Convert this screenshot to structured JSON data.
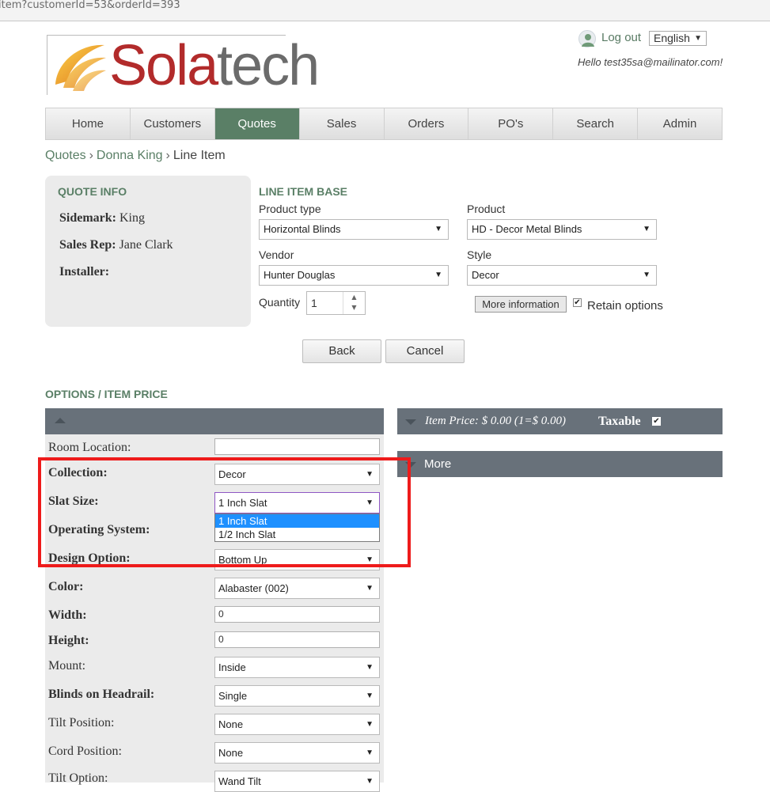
{
  "url": {
    "text": "item?customerId=53&orderId=393"
  },
  "brand": {
    "part1": "Sola",
    "part2": "tech"
  },
  "user": {
    "logout": "Log out",
    "language": "English",
    "greeting": "Hello test35sa@mailinator.com!"
  },
  "nav": {
    "tabs": [
      "Home",
      "Customers",
      "Quotes",
      "Sales",
      "Orders",
      "PO's",
      "Search",
      "Admin"
    ],
    "active": "Quotes"
  },
  "breadcrumb": {
    "b1": "Quotes",
    "b2": "Donna King",
    "b3": "Line Item",
    "sep": "›"
  },
  "quote_info": {
    "title": "QUOTE INFO",
    "sidemark_label": "Sidemark:",
    "sidemark_value": "King",
    "salesrep_label": "Sales Rep:",
    "salesrep_value": "Jane Clark",
    "installer_label": "Installer:"
  },
  "line_item_base": {
    "title": "LINE ITEM BASE",
    "product_type_label": "Product type",
    "product_type": "Horizontal Blinds",
    "product_label": "Product",
    "product": "HD - Decor Metal Blinds",
    "vendor_label": "Vendor",
    "vendor": "Hunter Douglas",
    "style_label": "Style",
    "style": "Decor",
    "quantity_label": "Quantity",
    "quantity": "1",
    "more_info": "More information",
    "retain_options": "Retain options"
  },
  "actions": {
    "back": "Back",
    "cancel": "Cancel"
  },
  "options": {
    "title": "OPTIONS / ITEM PRICE",
    "room_location_label": "Room Location:",
    "room_location": "",
    "collection_label": "Collection:",
    "collection": "Decor",
    "slat_size_label": "Slat Size:",
    "slat_size": "1 Inch Slat",
    "slat_options": [
      "1 Inch Slat",
      "1/2 Inch Slat"
    ],
    "operating_system_label": "Operating System:",
    "design_option_label": "Design Option:",
    "design_option": "Bottom Up",
    "color_label": "Color:",
    "color": "Alabaster (002)",
    "width_label": "Width:",
    "width": "0",
    "height_label": "Height:",
    "height": "0",
    "mount_label": "Mount:",
    "mount": "Inside",
    "headrail_label": "Blinds on Headrail:",
    "headrail": "Single",
    "tilt_position_label": "Tilt Position:",
    "tilt_position": "None",
    "cord_position_label": "Cord Position:",
    "cord_position": "None",
    "tilt_option_label": "Tilt Option:",
    "tilt_option": "Wand Tilt"
  },
  "price_panel": {
    "price_text": "Item Price: $ 0.00 (1=$ 0.00)",
    "taxable": "Taxable",
    "more": "More"
  },
  "colors": {
    "accent": "#5a7f66",
    "panel": "#68717a",
    "annotation": "#ee1b1b",
    "highlight": "#1e90ff"
  }
}
